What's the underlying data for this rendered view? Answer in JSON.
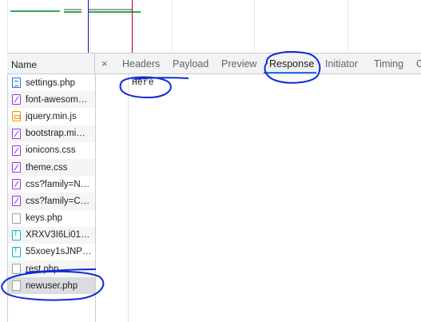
{
  "colors": {
    "accent": "#1a73e8",
    "annotation": "#0f2bd6",
    "timeline_green": "#34a853",
    "timeline_blue_line": "#1a0dab",
    "timeline_red_line": "#b00020"
  },
  "requests": {
    "header": "Name",
    "items": [
      {
        "name": "settings.php",
        "icon": "document-icon",
        "kind": "doc"
      },
      {
        "name": "font-awesom…",
        "icon": "stylesheet-icon",
        "kind": "css"
      },
      {
        "name": "jquery.min.js",
        "icon": "script-icon",
        "kind": "js"
      },
      {
        "name": "bootstrap.mi…",
        "icon": "stylesheet-icon",
        "kind": "css"
      },
      {
        "name": "ionicons.css",
        "icon": "stylesheet-icon",
        "kind": "css"
      },
      {
        "name": "theme.css",
        "icon": "stylesheet-icon",
        "kind": "css"
      },
      {
        "name": "css?family=N…",
        "icon": "stylesheet-icon",
        "kind": "css"
      },
      {
        "name": "css?family=C…",
        "icon": "stylesheet-icon",
        "kind": "css"
      },
      {
        "name": "keys.php",
        "icon": "file-icon",
        "kind": "blank"
      },
      {
        "name": "XRXV3I6Li01…",
        "icon": "font-icon",
        "kind": "font"
      },
      {
        "name": "55xoey1sJNP…",
        "icon": "font-icon",
        "kind": "font"
      },
      {
        "name": "rest.php",
        "icon": "file-icon",
        "kind": "blank"
      },
      {
        "name": "newuser.php",
        "icon": "file-icon",
        "kind": "blank",
        "selected": true
      }
    ]
  },
  "detail": {
    "close": "×",
    "tabs": [
      "Headers",
      "Payload",
      "Preview",
      "Response",
      "Initiator",
      "Timing",
      "C"
    ],
    "active_tab": "Response",
    "response_text": "Here"
  }
}
